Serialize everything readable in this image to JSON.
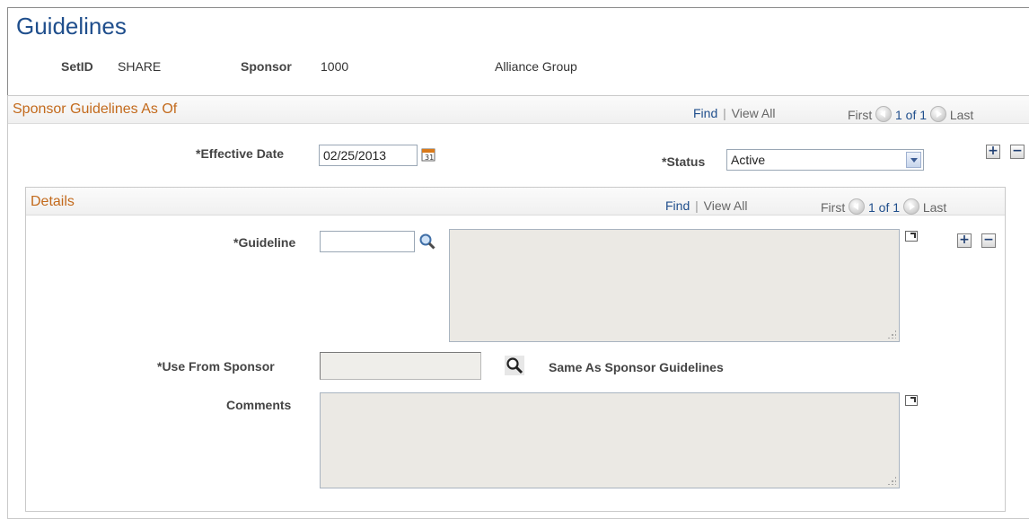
{
  "page": {
    "title": "Guidelines"
  },
  "header": {
    "setid_label": "SetID",
    "setid_value": "SHARE",
    "sponsor_label": "Sponsor",
    "sponsor_value": "1000",
    "sponsor_name": "Alliance Group"
  },
  "guidelines_section": {
    "title": "Sponsor Guidelines As Of",
    "find": "Find",
    "separator": "|",
    "view_all": "View All",
    "first": "First",
    "counter": "1 of 1",
    "last": "Last",
    "effective_date_label": "*Effective Date",
    "effective_date_value": "02/25/2013",
    "status_label": "*Status",
    "status_value": "Active",
    "add_symbol": "+",
    "remove_symbol": "−"
  },
  "details_section": {
    "title": "Details",
    "find": "Find",
    "separator": "|",
    "view_all": "View All",
    "first": "First",
    "counter": "1 of 1",
    "last": "Last",
    "guideline_label": "*Guideline",
    "guideline_value": "",
    "use_from_sponsor_label": "*Use From Sponsor",
    "use_from_sponsor_value": "",
    "same_as_sponsor_text": "Same As Sponsor Guidelines",
    "comments_label": "Comments",
    "add_symbol": "+",
    "remove_symbol": "−"
  },
  "icons": {
    "calendar": "calendar-icon",
    "lookup": "magnifier-icon",
    "expand": "expand-icon",
    "prev": "circle-left-arrow-icon",
    "next": "circle-right-arrow-icon"
  },
  "colors": {
    "title": "#1f4e8c",
    "section_title": "#c36a1c",
    "link": "#1f4e8c"
  }
}
